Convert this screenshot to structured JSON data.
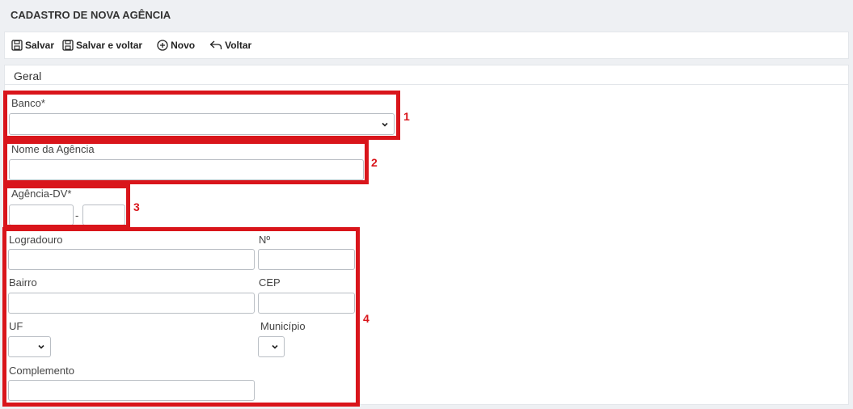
{
  "header": {
    "title": "CADASTRO DE NOVA AGÊNCIA"
  },
  "toolbar": {
    "save_label": "Salvar",
    "save_back_label": "Salvar e voltar",
    "new_label": "Novo",
    "back_label": "Voltar"
  },
  "panel": {
    "title": "Geral"
  },
  "form": {
    "banco_label": "Banco*",
    "banco_value": "",
    "nome_label": "Nome da Agência",
    "agencia_label": "Agência-DV*",
    "agencia_separator": "-",
    "logradouro_label": "Logradouro",
    "numero_label": "Nº",
    "bairro_label": "Bairro",
    "cep_label": "CEP",
    "uf_label": "UF",
    "municipio_label": "Município",
    "complemento_label": "Complemento"
  },
  "annotations": [
    "1",
    "2",
    "3",
    "4"
  ],
  "colors": {
    "highlight": "#d9151b",
    "background": "#eef0f3"
  },
  "icons": {
    "save": "floppy-disk-icon",
    "new": "plus-circle-icon",
    "back": "reply-arrow-icon",
    "dropdown": "chevron-down-icon"
  }
}
